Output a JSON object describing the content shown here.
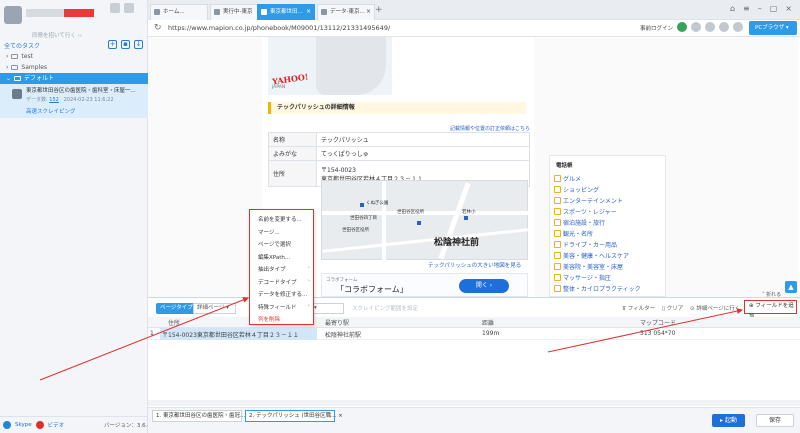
{
  "sidebar": {
    "invite": "同僚を招いて行く ››",
    "all_tasks": "全てのタスク",
    "tree": [
      {
        "label": "test"
      },
      {
        "label": "Samples"
      },
      {
        "label": "デフォルト"
      }
    ],
    "task": {
      "title": "東京都世田谷区の歯医院・歯科室・床屋一...",
      "data_label": "データ数:",
      "data_count": "152",
      "date": "2024-02-23 11:6:22",
      "quick": "高速スクレイピング"
    },
    "skype": "Skype",
    "video": "ビデオ",
    "version": "バージョン：3.6.4"
  },
  "browser": {
    "tabs": [
      {
        "label": "ホーム..."
      },
      {
        "label": "実行中-東京"
      },
      {
        "label": "東京都世田..."
      },
      {
        "label": "データ-東京..."
      }
    ],
    "url": "https://www.mapion.co.jp/phonebook/M09001/13112/21331495649/",
    "login": "事前ログイン",
    "pc_browser": "PCブラウザ"
  },
  "webpage": {
    "yahoo": "YAHOO!",
    "yahoo_sub": "JAPAN",
    "section_title": "テックパリッシュの詳細情報",
    "fix_link": "記載情報や位置の訂正依頼はこちら",
    "rows": [
      {
        "key": "名称",
        "value": "テックパリッシュ"
      },
      {
        "key": "よみがな",
        "value": "てっくぱりっしゅ"
      },
      {
        "key": "住所",
        "value": "〒154-0023\n東京都世田谷区若林４丁目２３－１１"
      }
    ],
    "map_labels": {
      "park": "くぬぎ公園",
      "station": "松陰神社前",
      "clinic": "世田谷区役所",
      "school": "若林小",
      "yard": "世田谷四丁目",
      "city": "世田谷区役所"
    },
    "map_link": "テックパリッシュの大きい地図を見る",
    "ad_label": "コラボフォーム",
    "ad_title": "「コラボフォーム」",
    "ad_button": "開く ›",
    "directory_title": "電話帳",
    "directory": [
      "グルメ",
      "ショッピング",
      "エンターテインメント",
      "スポーツ・レジャー",
      "宿泊施設・旅行",
      "観光・名所",
      "ドライブ・カー用品",
      "美容・健康・ヘルスケア",
      "美容院・美容室・床屋",
      "マッサージ・指圧",
      "整体・カイロプラクティック"
    ]
  },
  "context_menu": {
    "items": [
      {
        "label": "名前を変更する...",
        "submenu": false
      },
      {
        "label": "マージ...",
        "submenu": false
      },
      {
        "label": "ページで選択",
        "submenu": false
      },
      {
        "label": "編集XPath...",
        "submenu": false
      },
      {
        "label": "抽出タイプ",
        "submenu": true
      },
      {
        "label": "デコードタイプ",
        "submenu": true
      },
      {
        "label": "データを修正する...",
        "submenu": false
      },
      {
        "label": "特殊フィールド",
        "submenu": true
      },
      {
        "label": "列を削除",
        "submenu": false,
        "danger": true
      }
    ]
  },
  "panel": {
    "page_type": "ページタイプ",
    "detail_page": "詳細ページ",
    "scrape_range": "スクレイピング範囲を設定",
    "filter": "フィルター",
    "clear": "クリア",
    "detail_goto": "詳細ページに行く",
    "add_field": "フィールドを追加",
    "collapse": "折れる",
    "headers": [
      "住所",
      "最寄り駅",
      "距離",
      "マップコード"
    ],
    "rows": [
      {
        "num": "1",
        "cells": [
          "〒154-0023東京都世田谷区若林４丁目２３－１１",
          "松陰神社前駅",
          "199m",
          "513 054*70"
        ]
      }
    ]
  },
  "bottom": {
    "tabs": [
      {
        "label": "1. 東京都世田谷区の歯医院・歯冠..."
      },
      {
        "label": "2. テックパリッシュ (世田谷区職..."
      }
    ],
    "run": "▸ 起動",
    "save": "保存"
  },
  "colors": {
    "accent": "#2f9ae8",
    "annotation": "#e03030"
  }
}
